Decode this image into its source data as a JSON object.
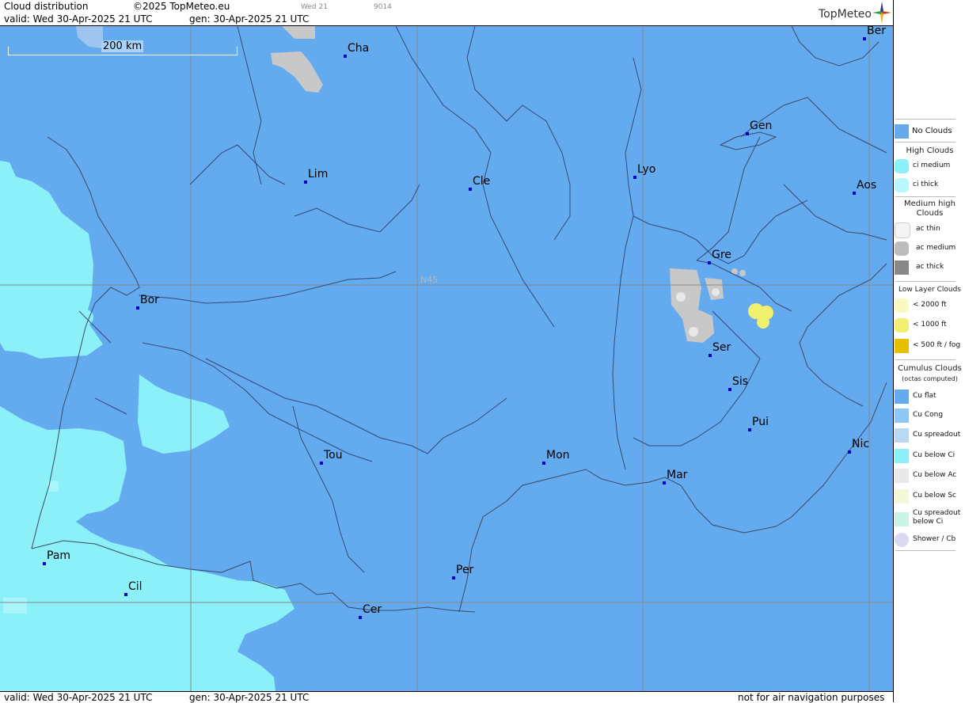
{
  "header": {
    "title": "Cloud distribution",
    "copyright": "©2025 TopMeteo.eu",
    "small_day": "Wed 21",
    "small_code": "9014",
    "valid": "valid:  Wed  30-Apr-2025  21 UTC",
    "gen": "gen: 30-Apr-2025  21 UTC",
    "logo": "TopMeteo"
  },
  "map": {
    "scale_label": "200 km",
    "lat_label": "N45",
    "colors": {
      "no_clouds": "#63aaee",
      "ci": "#8bf0f8",
      "ac": "#c0c0c0",
      "low": "#f0f070",
      "city": "#0000cc"
    },
    "cities": [
      {
        "name": "Cha"
      },
      {
        "name": "Ber"
      },
      {
        "name": "Lim"
      },
      {
        "name": "Cle"
      },
      {
        "name": "Lyo"
      },
      {
        "name": "Gen"
      },
      {
        "name": "Aos"
      },
      {
        "name": "Gre"
      },
      {
        "name": "Bor"
      },
      {
        "name": "Ser"
      },
      {
        "name": "Sis"
      },
      {
        "name": "Pui"
      },
      {
        "name": "Nic"
      },
      {
        "name": "Tou"
      },
      {
        "name": "Mon"
      },
      {
        "name": "Mar"
      },
      {
        "name": "Pam"
      },
      {
        "name": "Cil"
      },
      {
        "name": "Per"
      },
      {
        "name": "Cer"
      }
    ]
  },
  "footer": {
    "valid": "valid:  Wed  30-Apr-2025  21 UTC",
    "gen": "gen: 30-Apr-2025  21 UTC",
    "disclaimer": "not for air navigation purposes"
  },
  "legend": {
    "no_clouds": "No Clouds",
    "high_title": "High Clouds",
    "high": [
      "ci medium",
      "ci thick"
    ],
    "medium_title": "Medium high Clouds",
    "medium": [
      "ac thin",
      "ac medium",
      "ac thick"
    ],
    "low_title": "Low Layer Clouds",
    "low": [
      "< 2000 ft",
      "< 1000 ft",
      "< 500 ft / fog"
    ],
    "cumulus_title": "Cumulus Clouds",
    "cumulus_sub": "(octas computed)",
    "cumulus": [
      "Cu flat",
      "Cu Cong",
      "Cu spreadout",
      "Cu below Ci",
      "Cu below Ac",
      "Cu below Sc",
      "Cu spreadout below Ci",
      "Shower / Cb"
    ]
  }
}
